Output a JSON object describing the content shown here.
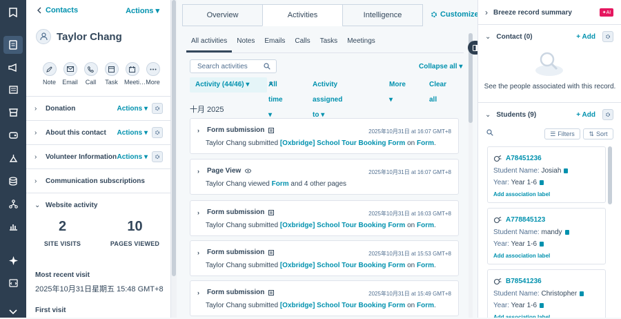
{
  "nav": {
    "icons": [
      "bookmark-icon",
      "contacts-icon",
      "megaphone-icon",
      "content-icon",
      "commerce-icon",
      "service-icon",
      "automation-icon",
      "data-icon",
      "sites-icon",
      "reports-icon",
      "sparkle-icon",
      "dev-icon",
      "expand-icon"
    ]
  },
  "left": {
    "breadcrumb": "Contacts",
    "actions": "Actions",
    "contact_name": "Taylor Chang",
    "quick_actions": [
      {
        "label": "Note",
        "icon": "note-icon"
      },
      {
        "label": "Email",
        "icon": "email-icon"
      },
      {
        "label": "Call",
        "icon": "phone-icon"
      },
      {
        "label": "Task",
        "icon": "task-icon"
      },
      {
        "label": "Meeti…",
        "icon": "meeting-icon"
      },
      {
        "label": "More",
        "icon": "more-icon"
      }
    ],
    "sections": [
      {
        "title": "Donation",
        "actions": "Actions",
        "gear": true
      },
      {
        "title": "About this contact",
        "actions": "Actions",
        "gear": true
      },
      {
        "title": "Volunteer Information",
        "actions": "Actions",
        "gear": true
      },
      {
        "title": "Communication subscriptions",
        "actions": "",
        "gear": false
      }
    ],
    "website_activity": {
      "title": "Website activity",
      "site_visits": "2",
      "site_visits_label": "SITE VISITS",
      "pages_viewed": "10",
      "pages_viewed_label": "PAGES VIEWED",
      "most_recent_label": "Most recent visit",
      "most_recent_value": "2025年10月31日星期五 15:48 GMT+8",
      "first_visit_label": "First visit"
    }
  },
  "middle": {
    "tabs": [
      "Overview",
      "Activities",
      "Intelligence"
    ],
    "active_tab": "Activities",
    "customize": "Customize",
    "subtabs": [
      "All activities",
      "Notes",
      "Emails",
      "Calls",
      "Tasks",
      "Meetings"
    ],
    "search_placeholder": "Search activities",
    "collapse_all": "Collapse all",
    "filters": {
      "activity": "Activity (44/46)",
      "all_time": "All time",
      "assigned": "Activity assigned to",
      "more": "More",
      "clear": "Clear all"
    },
    "month": "十月 2025",
    "activities": [
      {
        "type": "Form submission",
        "icon": "form-icon",
        "time": "2025年10月31日 at 16:07 GMT+8",
        "prefix": "Taylor Chang submitted ",
        "link": "[Oxbridge] School Tour Booking Form",
        "mid": " on ",
        "link2": "Form",
        "suffix": "."
      },
      {
        "type": "Page View",
        "icon": "eye-icon",
        "time": "2025年10月31日 at 16:07 GMT+8",
        "prefix": "Taylor Chang viewed ",
        "link": "Form",
        "mid": " and 4 other pages",
        "link2": "",
        "suffix": ""
      },
      {
        "type": "Form submission",
        "icon": "form-icon",
        "time": "2025年10月31日 at 16:03 GMT+8",
        "prefix": "Taylor Chang submitted ",
        "link": "[Oxbridge] School Tour Booking Form",
        "mid": " on ",
        "link2": "Form",
        "suffix": "."
      },
      {
        "type": "Form submission",
        "icon": "form-icon",
        "time": "2025年10月31日 at 15:53 GMT+8",
        "prefix": "Taylor Chang submitted ",
        "link": "[Oxbridge] School Tour Booking Form",
        "mid": " on ",
        "link2": "Form",
        "suffix": "."
      },
      {
        "type": "Form submission",
        "icon": "form-icon",
        "time": "2025年10月31日 at 15:49 GMT+8",
        "prefix": "Taylor Chang submitted ",
        "link": "[Oxbridge] School Tour Booking Form",
        "mid": " on ",
        "link2": "Form",
        "suffix": "."
      }
    ]
  },
  "right": {
    "breeze": "Breeze record summary",
    "ai_badge": "AI",
    "contact_title": "Contact (0)",
    "add": "Add",
    "empty_text": "See the people associated with this record.",
    "students_title": "Students (9)",
    "filters": "Filters",
    "sort": "Sort",
    "name_label": "Student Name:",
    "year_label": "Year:",
    "add_label": "Add association label",
    "students": [
      {
        "id": "A78451236",
        "name": "Josiah",
        "year": "Year 1-6"
      },
      {
        "id": "A778845123",
        "name": "mandy",
        "year": "Year 1-6"
      },
      {
        "id": "B78541236",
        "name": "Christopher",
        "year": "Year 1-6"
      }
    ]
  },
  "colors": {
    "accent": "#0091ae",
    "nav": "#2d3e50",
    "ai": "#e5175f"
  }
}
